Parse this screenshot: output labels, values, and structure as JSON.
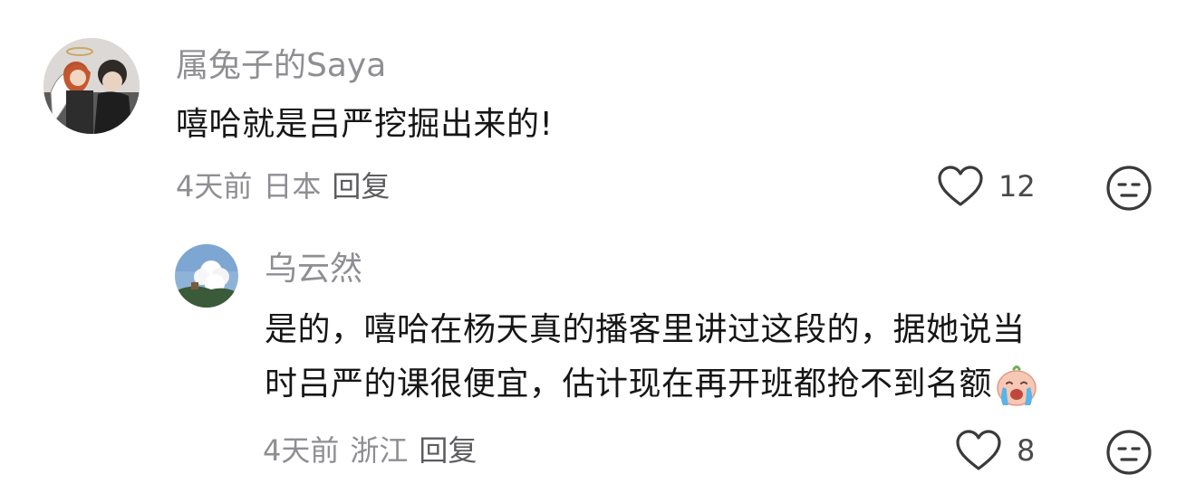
{
  "comments": [
    {
      "username": "属兔子的Saya",
      "text": "嘻哈就是吕严挖掘出来的!",
      "time": "4天前",
      "location": "日本",
      "reply_label": "回复",
      "likes": "12",
      "avatar_icon": "user-avatar-anime-photo"
    },
    {
      "username": "乌云然",
      "text_line1": "是的，嘻哈在杨天真的播客里讲过这段的，据她说当",
      "text_line2": "时吕严的课很便宜，估计现在再开班都抢不到名额",
      "emoji_icon": "crying-emoji-icon",
      "time": "4天前",
      "location": "浙江",
      "reply_label": "回复",
      "likes": "8",
      "avatar_icon": "user-avatar-clouds-photo"
    }
  ],
  "colors": {
    "secondary_text": "#8e8e93",
    "primary_text": "#161616",
    "icon_stroke": "#3a3a3c"
  }
}
